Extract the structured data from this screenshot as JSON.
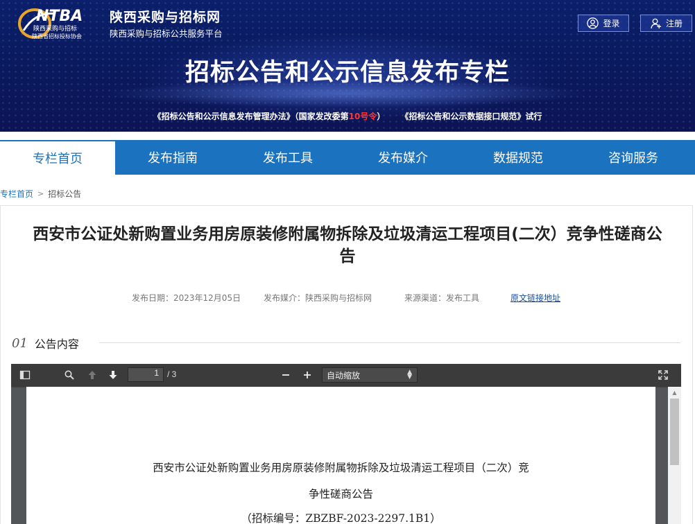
{
  "header": {
    "logo_text": "NTBA",
    "logo_subtitle_1": "陕西采购与招标",
    "logo_subtitle_2": "陕西省招标投标协会",
    "site_name": "陕西采购与招标网",
    "site_subtitle": "陕西采购与招标公共服务平台",
    "login_label": "登录",
    "register_label": "注册",
    "banner_title": "招标公告和公示信息发布专栏",
    "policy_1_pre": "《招标公告和公示信息发布管理办法》（国家发改委第",
    "policy_1_red": "10号令",
    "policy_1_post": "）",
    "policy_2": "《招标公告和公示数据接口规范》试行"
  },
  "nav": {
    "items": [
      {
        "label": "专栏首页"
      },
      {
        "label": "发布指南"
      },
      {
        "label": "发布工具"
      },
      {
        "label": "发布媒介"
      },
      {
        "label": "数据规范"
      },
      {
        "label": "咨询服务"
      }
    ]
  },
  "breadcrumb": {
    "home": "专栏首页",
    "separator": ">",
    "current": "招标公告"
  },
  "article": {
    "title_line1": "西安市公证处新购置业务用房原装修附属物拆除及垃圾清运工程项目(二次）竞争性磋商公",
    "title_line2": "告",
    "date": "发布日期：2023年12月05日",
    "media": "发布媒介：陕西采购与招标网",
    "source": "来源渠道：发布工具",
    "original_link": "原文链接地址"
  },
  "section": {
    "number": "01",
    "label": "公告内容"
  },
  "viewer": {
    "page_current": "1",
    "page_total": "/ 3",
    "zoom_value": "自动缩放",
    "doc_line1": "西安市公证处新购置业务用房原装修附属物拆除及垃圾清运工程项目（二次）竞",
    "doc_line2": "争性磋商公告",
    "doc_line3": "（招标编号：ZBZBF-2023-2297.1B1）"
  },
  "colors": {
    "nav_blue": "#1b72be",
    "banner_navy": "#0b1f6b",
    "policy_red": "#ff3333",
    "link_blue": "#1f4f9a"
  }
}
